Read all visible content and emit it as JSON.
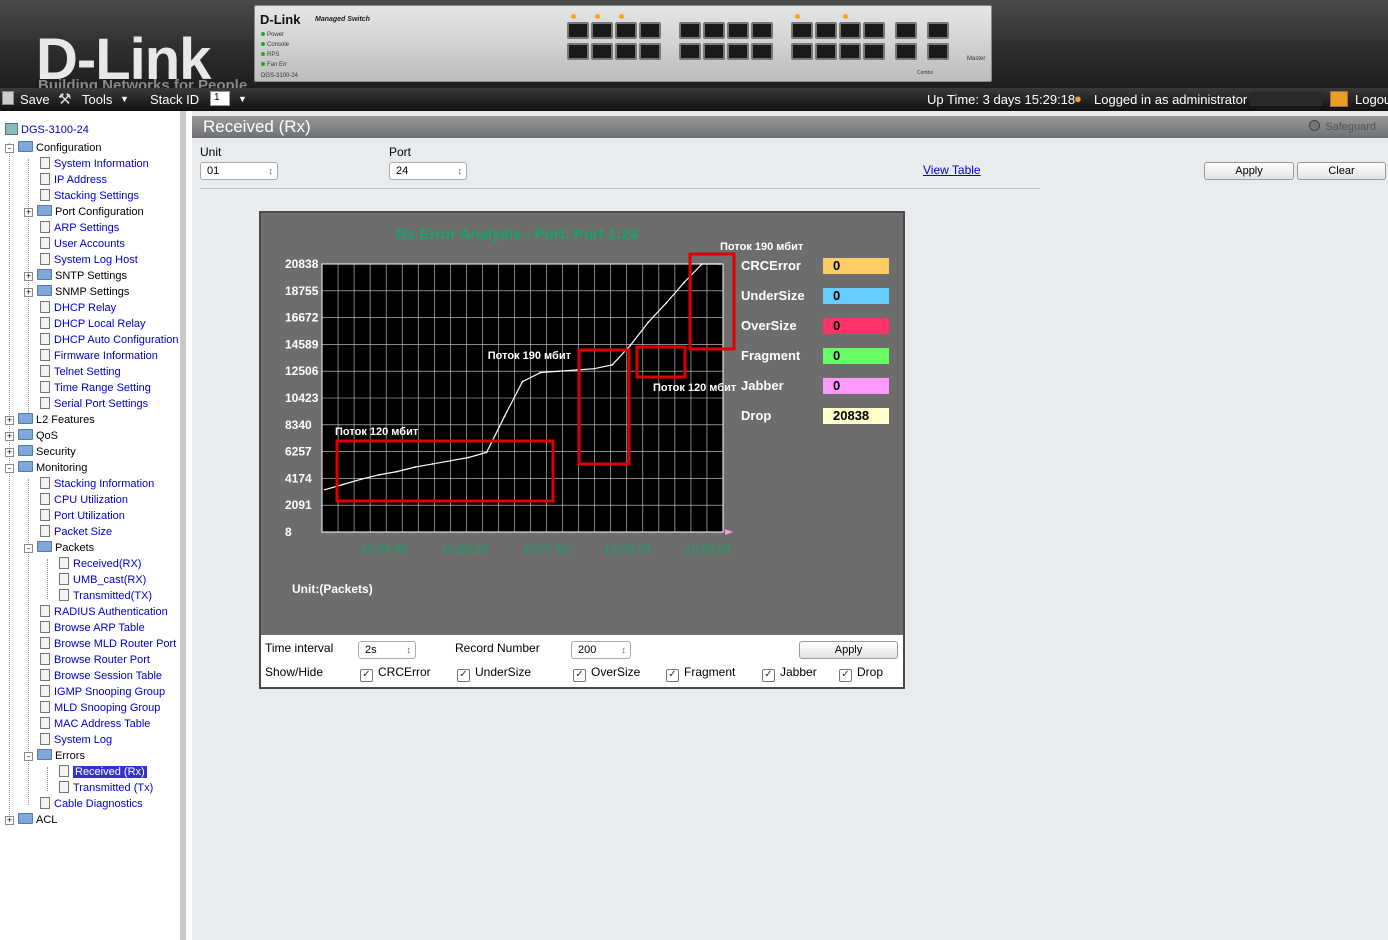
{
  "header": {
    "logo": "D-Link",
    "tagline": "Building Networks for People",
    "device_brand": "D-Link",
    "device_model_text": "Managed Switch",
    "device_sku": "DGS-3100-24",
    "device_leds": [
      "Power",
      "Console",
      "RPS",
      "Fan Err"
    ],
    "combo_label": "Combo",
    "master_label": "Master"
  },
  "toolbar": {
    "save_label": "Save",
    "tools_label": "Tools",
    "stack_id_label": "Stack ID",
    "stack_id_value": "1",
    "uptime": "Up Time: 3 days 15:29:18",
    "logged_in": "Logged in as administrator -",
    "logout_label": "Logout"
  },
  "sidebar": {
    "root": "DGS-3100-24",
    "configuration": "Configuration",
    "config_items": [
      "System Information",
      "IP Address",
      "Stacking Settings"
    ],
    "port_configuration": "Port Configuration",
    "config_items2": [
      "ARP Settings",
      "User Accounts",
      "System Log Host"
    ],
    "sntp": "SNTP Settings",
    "snmp": "SNMP Settings",
    "config_items3": [
      "DHCP Relay",
      "DHCP Local Relay",
      "DHCP Auto Configuration",
      "Firmware Information",
      "Telnet Setting",
      "Time Range Setting",
      "Serial Port Settings"
    ],
    "l2": "L2 Features",
    "qos": "QoS",
    "security": "Security",
    "monitoring": "Monitoring",
    "monitor_items": [
      "Stacking Information",
      "CPU Utilization",
      "Port Utilization",
      "Packet Size"
    ],
    "packets": "Packets",
    "packets_items": [
      "Received(RX)",
      "UMB_cast(RX)",
      "Transmitted(TX)"
    ],
    "monitor_items2": [
      "RADIUS Authentication",
      "Browse ARP Table",
      "Browse MLD Router Port",
      "Browse Router Port",
      "Browse Session Table",
      "IGMP Snooping Group",
      "MLD Snooping Group",
      "MAC Address Table",
      "System Log"
    ],
    "errors": "Errors",
    "errors_items": [
      "Received (Rx)",
      "Transmitted (Tx)"
    ],
    "cable_diag": "Cable Diagnostics",
    "acl": "ACL"
  },
  "main": {
    "title": "Received (Rx)",
    "safeguard": "Safeguard",
    "unit_label": "Unit",
    "unit_value": "01",
    "port_label": "Port",
    "port_value": "24",
    "view_table": "View Table",
    "apply_label": "Apply",
    "clear_label": "Clear"
  },
  "controls": {
    "time_interval_label": "Time interval",
    "time_interval_value": "2s",
    "record_number_label": "Record Number",
    "record_number_value": "200",
    "apply_label": "Apply",
    "show_hide_label": "Show/Hide",
    "checks": [
      "CRCError",
      "UnderSize",
      "OverSize",
      "Fragment",
      "Jabber",
      "Drop"
    ]
  },
  "chart_data": {
    "type": "line",
    "title": "Rx Error Analysis - Port: Port 1:24",
    "unit_label": "Unit:(Packets)",
    "y_ticks": [
      8,
      2091,
      4174,
      6257,
      8340,
      10423,
      12506,
      14589,
      16672,
      18755,
      20838
    ],
    "ylim": [
      8,
      20838
    ],
    "x_ticks": [
      "10:24:48",
      "10:26:20",
      "10:27:52",
      "10:29:23",
      "10:30:54"
    ],
    "x": [
      0,
      1,
      2,
      3,
      4,
      5,
      6,
      7,
      8,
      9,
      10,
      11,
      12,
      13,
      14,
      15,
      16,
      17,
      18,
      19,
      20,
      21,
      22
    ],
    "series": [
      {
        "name": "Drop",
        "values": [
          3300,
          3700,
          4100,
          4450,
          4700,
          5050,
          5300,
          5550,
          5800,
          6200,
          9000,
          11700,
          12400,
          12500,
          12600,
          12700,
          13000,
          14500,
          16300,
          17800,
          19400,
          20838,
          20838
        ]
      }
    ],
    "legend": [
      {
        "name": "CRCError",
        "value": "0",
        "color": "#ffcc66"
      },
      {
        "name": "UnderSize",
        "value": "0",
        "color": "#66ccff"
      },
      {
        "name": "OverSize",
        "value": "0",
        "color": "#ff3366"
      },
      {
        "name": "Fragment",
        "value": "0",
        "color": "#66ff66"
      },
      {
        "name": "Jabber",
        "value": "0",
        "color": "#ff99ff"
      },
      {
        "name": "Drop",
        "value": "20838",
        "color": "#ffffcc"
      }
    ],
    "annotations": [
      "Поток 120 мбит",
      "Поток 190 мбит",
      "Поток 120 мбит",
      "Поток 190 мбит"
    ],
    "title_color": "#1aa36b",
    "xtick_color": "#1aa36b",
    "box_color": "#e00000"
  }
}
